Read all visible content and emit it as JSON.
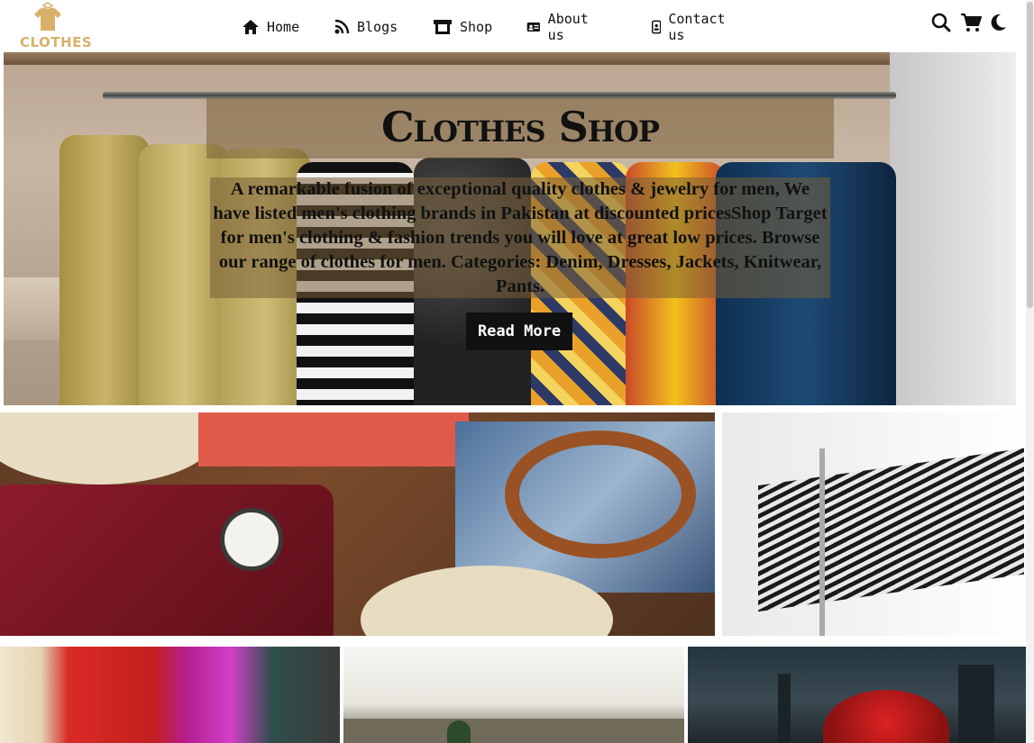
{
  "brand": {
    "logo_text": "CLOTHES",
    "accent": "#d9b06a"
  },
  "nav": {
    "items": [
      {
        "label": "Home",
        "icon": "home-icon"
      },
      {
        "label": "Blogs",
        "icon": "rss-icon"
      },
      {
        "label": "Shop",
        "icon": "store-icon"
      },
      {
        "label": "About us",
        "icon": "id-card-icon"
      },
      {
        "label": "Contact us",
        "icon": "contact-badge-icon"
      }
    ]
  },
  "header_icons": [
    "search-icon",
    "cart-icon",
    "moon-icon"
  ],
  "hero": {
    "title": "Clothes Shop",
    "description": "A remarkable fusion of exceptional quality clothes & jewelry for men, We have listed men's clothing brands in Pakistan at discounted pricesShop Target for men's clothing & fashion trends you will love at great low prices. Browse our range of clothes for men. Categories: Denim, Dresses, Jackets, Knitwear, Pants.",
    "button_label": "Read More"
  }
}
